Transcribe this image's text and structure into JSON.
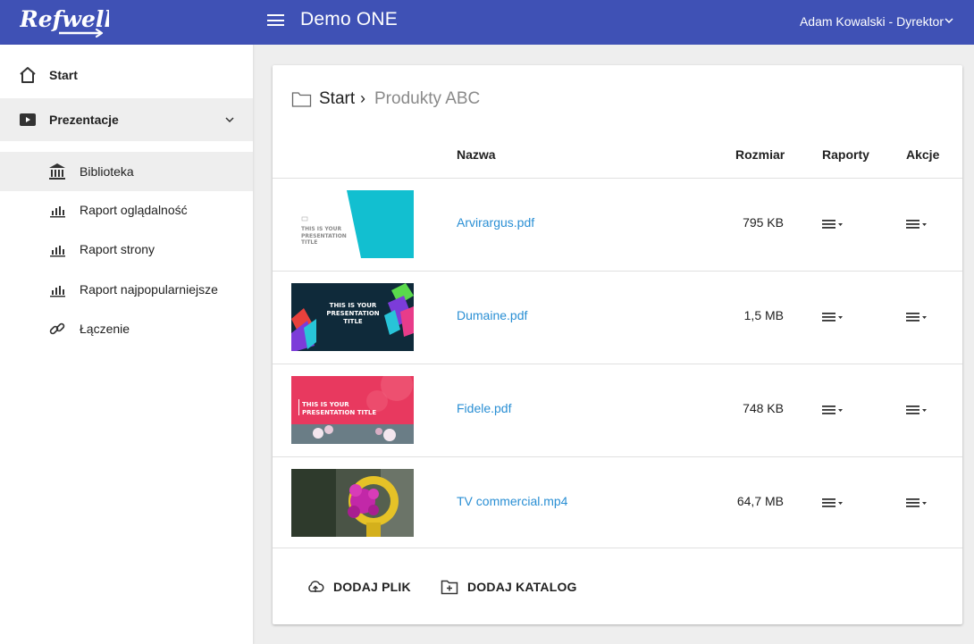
{
  "app": {
    "logo_text": "Refwell",
    "title": "Demo ONE",
    "user": "Adam Kowalski - Dyrektor"
  },
  "sidebar": {
    "items": [
      {
        "label": "Start",
        "icon": "home-icon"
      },
      {
        "label": "Prezentacje",
        "icon": "play-icon"
      }
    ],
    "sub_items": [
      {
        "label": "Biblioteka",
        "icon": "library-icon"
      },
      {
        "label": "Raport oglądalność",
        "icon": "bar-chart-icon"
      },
      {
        "label": "Raport strony",
        "icon": "bar-chart-icon"
      },
      {
        "label": "Raport najpopularniejsze",
        "icon": "bar-chart-icon"
      },
      {
        "label": "Łączenie",
        "icon": "link-icon"
      }
    ]
  },
  "breadcrumb": {
    "root": "Start",
    "separator": "›",
    "current": "Produkty ABC"
  },
  "table": {
    "headers": {
      "name": "Nazwa",
      "size": "Rozmiar",
      "reports": "Raporty",
      "actions": "Akcje"
    },
    "rows": [
      {
        "name": "Arvirargus.pdf",
        "size": "795 KB",
        "thumb_title": "THIS IS YOUR PRESENTATION TITLE"
      },
      {
        "name": "Dumaine.pdf",
        "size": "1,5 MB",
        "thumb_title": "THIS IS YOUR PRESENTATION TITLE"
      },
      {
        "name": "Fidele.pdf",
        "size": "748 KB",
        "thumb_title": "THIS IS YOUR PRESENTATION TITLE"
      },
      {
        "name": "TV commercial.mp4",
        "size": "64,7 MB"
      }
    ]
  },
  "footer": {
    "add_file": "DODAJ PLIK",
    "add_folder": "DODAJ KATALOG"
  },
  "colors": {
    "primary": "#3f51b5",
    "link": "#2a8fd4",
    "selected_bg": "#eeeeee"
  }
}
